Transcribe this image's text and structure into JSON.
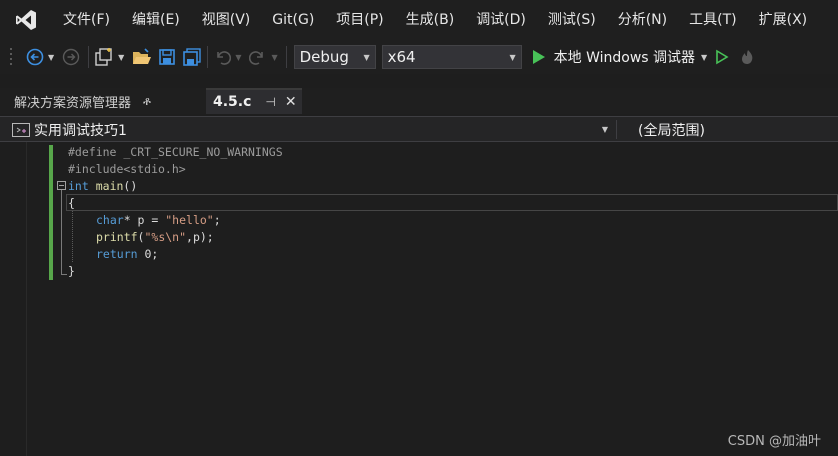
{
  "menu": [
    "文件(F)",
    "编辑(E)",
    "视图(V)",
    "Git(G)",
    "项目(P)",
    "生成(B)",
    "调试(D)",
    "测试(S)",
    "分析(N)",
    "工具(T)",
    "扩展(X)"
  ],
  "toolbar": {
    "config": "Debug",
    "platform": "x64",
    "run_label": "本地 Windows 调试器"
  },
  "tabs": {
    "solution_explorer": "解决方案资源管理器",
    "pin_glyph": "ቶ",
    "file_tab": "4.5.c",
    "file_pin_glyph": "⊣",
    "close_glyph": "✕"
  },
  "navbar": {
    "project": "实用调试技巧1",
    "scope": "(全局范围)"
  },
  "code": {
    "line1": "#define _CRT_SECURE_NO_WARNINGS",
    "line2": "#include<stdio.h>",
    "line3_kw": "int",
    "line3_fn": "main",
    "line3_rest": "()",
    "line4": "{",
    "line5_kw": "char",
    "line5_rest": "* p = ",
    "line5_str": "\"hello\"",
    "line5_end": ";",
    "line6_fn": "printf",
    "line6_open": "(",
    "line6_str": "\"%s\\n\"",
    "line6_rest": ",p);",
    "line7_kw": "return",
    "line7_rest": " 0;",
    "line8": "}"
  },
  "watermark": "CSDN @加油叶",
  "colors": {
    "accent_green": "#57a64a",
    "keyword": "#569cd6",
    "string": "#d69d85"
  }
}
